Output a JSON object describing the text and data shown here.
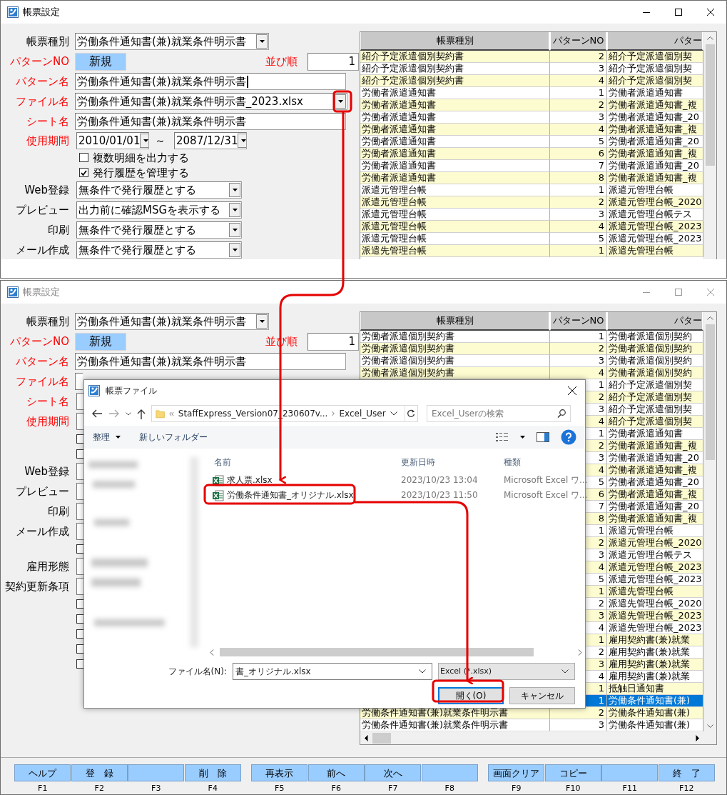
{
  "top_window": {
    "title": "帳票設定",
    "active": true,
    "form": [
      {
        "kind": "select",
        "label": "帳票種別",
        "required": false,
        "value": "労働条件通知書(兼)就業条件明示書"
      },
      {
        "kind": "pattern",
        "label": "パターンNO",
        "required": true,
        "value": "新規",
        "order_label": "並び順",
        "order_value": "1"
      },
      {
        "kind": "text",
        "label": "パターン名",
        "required": true,
        "value": "労働条件通知書(兼)就業条件明示書",
        "focused": true
      },
      {
        "kind": "file",
        "label": "ファイル名",
        "required": true,
        "value": "労働条件通知書(兼)就業条件明示書_2023.xlsx"
      },
      {
        "kind": "text",
        "label": "シート名",
        "required": true,
        "value": "労働条件通知書(兼)就業条件明示書",
        "focused": false
      },
      {
        "kind": "dates",
        "label": "使用期間",
        "required": true,
        "from": "2010/01/01",
        "separator": "～",
        "to": "2087/12/31"
      },
      {
        "kind": "checkbox",
        "label": "複数明細を出力する",
        "checked": false
      },
      {
        "kind": "checkbox",
        "label": "発行履歴を管理する",
        "checked": true
      },
      {
        "kind": "combo",
        "label": "Web登録",
        "required": false,
        "value": "無条件で発行履歴とする"
      },
      {
        "kind": "combo",
        "label": "プレビュー",
        "required": false,
        "value": "出力前に確認MSGを表示する"
      },
      {
        "kind": "combo",
        "label": "印刷",
        "required": false,
        "value": "無条件で発行履歴とする"
      },
      {
        "kind": "combo",
        "label": "メール作成",
        "required": false,
        "value": "無条件で発行履歴とする"
      }
    ],
    "table": {
      "columns": [
        "帳票種別",
        "パターンNO",
        "パター"
      ],
      "rows": [
        {
          "form_type": "紹介予定派遣個別契約書",
          "pattern_no": "2",
          "pattern_name": "紹介予定派遣個別契",
          "shaded": true,
          "selected": false
        },
        {
          "form_type": "紹介予定派遣個別契約書",
          "pattern_no": "3",
          "pattern_name": "紹介予定派遣個別契",
          "shaded": false,
          "selected": false
        },
        {
          "form_type": "紹介予定派遣個別契約書",
          "pattern_no": "4",
          "pattern_name": "紹介予定派遣個別契",
          "shaded": true,
          "selected": false
        },
        {
          "form_type": "労働者派遣通知書",
          "pattern_no": "1",
          "pattern_name": "労働者派遣通知書",
          "shaded": false,
          "selected": false
        },
        {
          "form_type": "労働者派遣通知書",
          "pattern_no": "2",
          "pattern_name": "労働者派遣通知書_複",
          "shaded": true,
          "selected": false
        },
        {
          "form_type": "労働者派遣通知書",
          "pattern_no": "3",
          "pattern_name": "労働者派遣通知書_20",
          "shaded": false,
          "selected": false
        },
        {
          "form_type": "労働者派遣通知書",
          "pattern_no": "4",
          "pattern_name": "労働者派遣通知書_複",
          "shaded": true,
          "selected": false
        },
        {
          "form_type": "労働者派遣通知書",
          "pattern_no": "5",
          "pattern_name": "労働者派遣通知書_20",
          "shaded": false,
          "selected": false
        },
        {
          "form_type": "労働者派遣通知書",
          "pattern_no": "6",
          "pattern_name": "労働者派遣通知書_複",
          "shaded": true,
          "selected": false
        },
        {
          "form_type": "労働者派遣通知書",
          "pattern_no": "7",
          "pattern_name": "労働者派遣通知書_20",
          "shaded": false,
          "selected": false
        },
        {
          "form_type": "労働者派遣通知書",
          "pattern_no": "8",
          "pattern_name": "労働者派遣通知書_複",
          "shaded": true,
          "selected": false
        },
        {
          "form_type": "派遣元管理台帳",
          "pattern_no": "1",
          "pattern_name": "派遣元管理台帳",
          "shaded": false,
          "selected": false
        },
        {
          "form_type": "派遣元管理台帳",
          "pattern_no": "2",
          "pattern_name": "派遣元管理台帳_2020",
          "shaded": true,
          "selected": false
        },
        {
          "form_type": "派遣元管理台帳",
          "pattern_no": "3",
          "pattern_name": "派遣元管理台帳テス",
          "shaded": false,
          "selected": false
        },
        {
          "form_type": "派遣元管理台帳",
          "pattern_no": "4",
          "pattern_name": "派遣元管理台帳_2023",
          "shaded": true,
          "selected": false
        },
        {
          "form_type": "派遣元管理台帳",
          "pattern_no": "5",
          "pattern_name": "派遣元管理台帳_2023",
          "shaded": false,
          "selected": false
        },
        {
          "form_type": "派遣先管理台帳",
          "pattern_no": "1",
          "pattern_name": "派遣先管理台帳",
          "shaded": true,
          "selected": false
        }
      ]
    }
  },
  "bottom_window": {
    "title": "帳票設定",
    "active": false,
    "form": [
      {
        "kind": "select",
        "label": "帳票種別",
        "required": false,
        "value": "労働条件通知書(兼)就業条件明示書"
      },
      {
        "kind": "pattern",
        "label": "パターンNO",
        "required": true,
        "value": "新規",
        "order_label": "並び順",
        "order_value": "1"
      },
      {
        "kind": "text",
        "label": "パターン名",
        "required": true,
        "value": "労働条件通知書(兼)就業条件明示書",
        "focused": false
      },
      {
        "kind": "file-stub",
        "label": "ファイル名",
        "required": true
      },
      {
        "kind": "stub",
        "label": "シート名",
        "required": true
      },
      {
        "kind": "stub",
        "label": "使用期間",
        "required": true
      },
      {
        "kind": "check-stub"
      },
      {
        "kind": "check-stub"
      },
      {
        "kind": "stub",
        "label": "Web登録",
        "required": false
      },
      {
        "kind": "stub",
        "label": "プレビュー",
        "required": false
      },
      {
        "kind": "stub",
        "label": "印刷",
        "required": false
      },
      {
        "kind": "stub",
        "label": "メール作成",
        "required": false
      },
      {
        "kind": "check-stub"
      },
      {
        "kind": "stub",
        "label": "雇用形態",
        "required": false
      },
      {
        "kind": "stub",
        "label": "契約更新条項",
        "required": false
      },
      {
        "kind": "check-stub"
      },
      {
        "kind": "check-stub"
      },
      {
        "kind": "check-stub"
      },
      {
        "kind": "check-stub"
      },
      {
        "kind": "check-stub"
      }
    ],
    "table": {
      "columns": [
        "帳票種別",
        "パターンNO",
        "パター"
      ],
      "rows": [
        {
          "form_type": "労働者派遣個別契約書",
          "pattern_no": "1",
          "pattern_name": "労働者派遣個別契約",
          "shaded": false,
          "selected": false
        },
        {
          "form_type": "労働者派遣個別契約書",
          "pattern_no": "2",
          "pattern_name": "労働者派遣個別契約",
          "shaded": true,
          "selected": false
        },
        {
          "form_type": "労働者派遣個別契約書",
          "pattern_no": "3",
          "pattern_name": "労働者派遣個別契約",
          "shaded": false,
          "selected": false
        },
        {
          "form_type": "労働者派遣個別契約書",
          "pattern_no": "4",
          "pattern_name": "労働者派遣個別契約",
          "shaded": true,
          "selected": false
        },
        {
          "pattern_no": "1",
          "pattern_name": "紹介予定派遣個別契",
          "shaded": false,
          "selected": false
        },
        {
          "pattern_no": "2",
          "pattern_name": "紹介予定派遣個別契",
          "shaded": true,
          "selected": false
        },
        {
          "pattern_no": "3",
          "pattern_name": "紹介予定派遣個別契",
          "shaded": false,
          "selected": false
        },
        {
          "pattern_no": "4",
          "pattern_name": "紹介予定派遣個別契",
          "shaded": true,
          "selected": false
        },
        {
          "pattern_no": "1",
          "pattern_name": "労働者派遣通知書",
          "shaded": false,
          "selected": false
        },
        {
          "pattern_no": "2",
          "pattern_name": "労働者派遣通知書_複",
          "shaded": true,
          "selected": false
        },
        {
          "pattern_no": "3",
          "pattern_name": "労働者派遣通知書_20",
          "shaded": false,
          "selected": false
        },
        {
          "pattern_no": "4",
          "pattern_name": "労働者派遣通知書_複",
          "shaded": true,
          "selected": false
        },
        {
          "pattern_no": "5",
          "pattern_name": "労働者派遣通知書_20",
          "shaded": false,
          "selected": false
        },
        {
          "pattern_no": "6",
          "pattern_name": "労働者派遣通知書_複",
          "shaded": true,
          "selected": false
        },
        {
          "pattern_no": "7",
          "pattern_name": "労働者派遣通知書_20",
          "shaded": false,
          "selected": false
        },
        {
          "pattern_no": "8",
          "pattern_name": "労働者派遣通知書_複",
          "shaded": true,
          "selected": false
        },
        {
          "pattern_no": "1",
          "pattern_name": "派遣元管理台帳",
          "shaded": false,
          "selected": false
        },
        {
          "pattern_no": "2",
          "pattern_name": "派遣元管理台帳_2020",
          "shaded": true,
          "selected": false
        },
        {
          "pattern_no": "3",
          "pattern_name": "派遣元管理台帳テス",
          "shaded": false,
          "selected": false
        },
        {
          "pattern_no": "4",
          "pattern_name": "派遣元管理台帳_2023",
          "shaded": true,
          "selected": false
        },
        {
          "pattern_no": "5",
          "pattern_name": "派遣元管理台帳_2023",
          "shaded": false,
          "selected": false
        },
        {
          "pattern_no": "1",
          "pattern_name": "派遣先管理台帳",
          "shaded": true,
          "selected": false
        },
        {
          "pattern_no": "2",
          "pattern_name": "派遣先管理台帳_2020",
          "shaded": false,
          "selected": false
        },
        {
          "pattern_no": "3",
          "pattern_name": "派遣先管理台帳_2023",
          "shaded": true,
          "selected": false
        },
        {
          "pattern_no": "4",
          "pattern_name": "派遣先管理台帳_2023",
          "shaded": false,
          "selected": false
        },
        {
          "pattern_no": "1",
          "pattern_name": "雇用契約書(兼)就業",
          "shaded": true,
          "selected": false
        },
        {
          "pattern_no": "2",
          "pattern_name": "雇用契約書(兼)就業",
          "shaded": false,
          "selected": false
        },
        {
          "pattern_no": "3",
          "pattern_name": "雇用契約書(兼)就業",
          "shaded": true,
          "selected": false
        },
        {
          "pattern_no": "4",
          "pattern_name": "雇用契約書(兼)就業",
          "shaded": false,
          "selected": false
        },
        {
          "pattern_no": "1",
          "pattern_name": "抵触日通知書",
          "shaded": true,
          "selected": false
        },
        {
          "pattern_no": "1",
          "pattern_name": "労働条件通知書(兼)",
          "selected": true
        },
        {
          "form_type": "労働条件通知書(兼)就業条件明示書",
          "pattern_no": "2",
          "pattern_name": "労働条件通知書(兼)",
          "shaded": true,
          "selected": false
        },
        {
          "form_type": "労働条件通知書(兼)就業条件明示書",
          "pattern_no": "3",
          "pattern_name": "労働条件通知書(兼)",
          "shaded": false,
          "selected": false
        }
      ]
    },
    "function_keys": [
      {
        "label": "ヘルプ",
        "key": "F1"
      },
      {
        "label": "登　録",
        "key": "F2"
      },
      {
        "key": "F3"
      },
      {
        "label": "削　除",
        "key": "F4"
      },
      {
        "label": "再表示",
        "key": "F5"
      },
      {
        "label": "前へ",
        "key": "F6"
      },
      {
        "label": "次へ",
        "key": "F7"
      },
      {
        "key": "F8"
      },
      {
        "label": "画面クリア",
        "key": "F9"
      },
      {
        "label": "コピー",
        "key": "F10"
      },
      {
        "key": "F11"
      },
      {
        "label": "終　了",
        "key": "F12"
      }
    ]
  },
  "file_dialog": {
    "title": "帳票ファイル",
    "path": [
      "StaffExpress_Version07_230607v...",
      "Excel_User"
    ],
    "search_placeholder": "Excel_Userの検索",
    "toolbar": [
      {
        "label": "整理",
        "dropdown": true
      },
      {
        "label": "新しいフォルダー",
        "dropdown": false
      }
    ],
    "columns": [
      "名前",
      "更新日時",
      "種類"
    ],
    "files": [
      {
        "name": "求人票.xlsx",
        "modified": "2023/10/23 13:04",
        "type": "Microsoft Excel ワ...",
        "selected": false
      },
      {
        "name": "労働条件通知書_オリジナル.xlsx",
        "modified": "2023/10/23 11:50",
        "type": "Microsoft Excel ワ...",
        "selected": false
      }
    ],
    "filename_label": "ファイル名(N):",
    "filename": "書_オリジナル.xlsx",
    "filetype": "Excel (*.xlsx)",
    "buttons": [
      {
        "label": "開く(O)",
        "default": true
      },
      {
        "label": "キャンセル",
        "default": false
      }
    ]
  }
}
